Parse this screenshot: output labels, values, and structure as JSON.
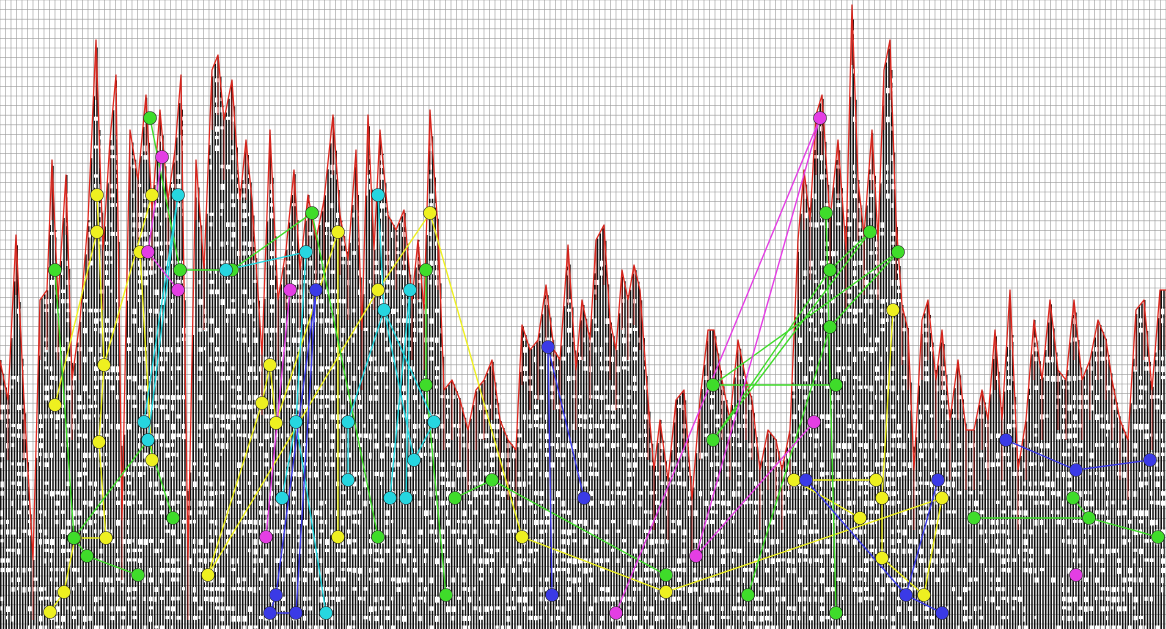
{
  "chart_data": {
    "type": "line",
    "colors": {
      "background": "#ffffff",
      "grid": "#9a9a9a",
      "bars": "#111111",
      "line": "#e0281e",
      "yellow": "#eef020",
      "green": "#3fdc2a",
      "cyan": "#26d6e0",
      "magenta": "#e43ee4",
      "blue": "#3a3ae6"
    },
    "profile": [
      [
        0,
        360
      ],
      [
        8,
        400
      ],
      [
        16,
        235
      ],
      [
        24,
        400
      ],
      [
        33,
        560
      ],
      [
        40,
        300
      ],
      [
        47,
        290
      ],
      [
        52,
        160
      ],
      [
        58,
        300
      ],
      [
        66,
        175
      ],
      [
        72,
        380
      ],
      [
        80,
        320
      ],
      [
        88,
        220
      ],
      [
        96,
        40
      ],
      [
        103,
        250
      ],
      [
        110,
        140
      ],
      [
        116,
        75
      ],
      [
        122,
        520
      ],
      [
        130,
        130
      ],
      [
        138,
        180
      ],
      [
        146,
        95
      ],
      [
        152,
        210
      ],
      [
        160,
        110
      ],
      [
        168,
        200
      ],
      [
        175,
        150
      ],
      [
        181,
        75
      ],
      [
        188,
        560
      ],
      [
        196,
        160
      ],
      [
        204,
        270
      ],
      [
        212,
        70
      ],
      [
        218,
        55
      ],
      [
        224,
        120
      ],
      [
        232,
        80
      ],
      [
        240,
        200
      ],
      [
        246,
        140
      ],
      [
        252,
        200
      ],
      [
        262,
        355
      ],
      [
        270,
        130
      ],
      [
        278,
        300
      ],
      [
        286,
        250
      ],
      [
        294,
        170
      ],
      [
        300,
        270
      ],
      [
        308,
        195
      ],
      [
        316,
        240
      ],
      [
        324,
        200
      ],
      [
        333,
        115
      ],
      [
        340,
        215
      ],
      [
        348,
        260
      ],
      [
        356,
        150
      ],
      [
        362,
        330
      ],
      [
        368,
        115
      ],
      [
        374,
        250
      ],
      [
        380,
        130
      ],
      [
        388,
        215
      ],
      [
        396,
        230
      ],
      [
        404,
        210
      ],
      [
        412,
        300
      ],
      [
        418,
        240
      ],
      [
        424,
        310
      ],
      [
        430,
        110
      ],
      [
        438,
        230
      ],
      [
        444,
        390
      ],
      [
        452,
        380
      ],
      [
        460,
        400
      ],
      [
        468,
        430
      ],
      [
        476,
        390
      ],
      [
        484,
        380
      ],
      [
        492,
        360
      ],
      [
        500,
        420
      ],
      [
        508,
        440
      ],
      [
        516,
        450
      ],
      [
        522,
        325
      ],
      [
        530,
        350
      ],
      [
        538,
        340
      ],
      [
        546,
        285
      ],
      [
        554,
        350
      ],
      [
        560,
        360
      ],
      [
        568,
        245
      ],
      [
        576,
        370
      ],
      [
        582,
        300
      ],
      [
        590,
        340
      ],
      [
        596,
        240
      ],
      [
        604,
        225
      ],
      [
        610,
        320
      ],
      [
        616,
        350
      ],
      [
        622,
        270
      ],
      [
        628,
        300
      ],
      [
        634,
        265
      ],
      [
        640,
        290
      ],
      [
        648,
        400
      ],
      [
        654,
        470
      ],
      [
        660,
        420
      ],
      [
        668,
        480
      ],
      [
        676,
        400
      ],
      [
        684,
        390
      ],
      [
        692,
        500
      ],
      [
        700,
        400
      ],
      [
        708,
        330
      ],
      [
        714,
        330
      ],
      [
        722,
        380
      ],
      [
        730,
        420
      ],
      [
        738,
        340
      ],
      [
        746,
        380
      ],
      [
        752,
        400
      ],
      [
        760,
        470
      ],
      [
        768,
        430
      ],
      [
        776,
        440
      ],
      [
        782,
        470
      ],
      [
        790,
        430
      ],
      [
        798,
        240
      ],
      [
        804,
        170
      ],
      [
        810,
        220
      ],
      [
        816,
        115
      ],
      [
        822,
        95
      ],
      [
        830,
        220
      ],
      [
        838,
        140
      ],
      [
        846,
        250
      ],
      [
        852,
        5
      ],
      [
        858,
        180
      ],
      [
        864,
        235
      ],
      [
        872,
        130
      ],
      [
        878,
        240
      ],
      [
        884,
        70
      ],
      [
        890,
        40
      ],
      [
        896,
        220
      ],
      [
        902,
        305
      ],
      [
        908,
        330
      ],
      [
        914,
        470
      ],
      [
        922,
        320
      ],
      [
        928,
        300
      ],
      [
        936,
        380
      ],
      [
        942,
        330
      ],
      [
        950,
        420
      ],
      [
        958,
        360
      ],
      [
        966,
        430
      ],
      [
        974,
        430
      ],
      [
        982,
        390
      ],
      [
        988,
        420
      ],
      [
        995,
        330
      ],
      [
        1002,
        420
      ],
      [
        1010,
        290
      ],
      [
        1018,
        470
      ],
      [
        1026,
        420
      ],
      [
        1034,
        320
      ],
      [
        1042,
        380
      ],
      [
        1050,
        300
      ],
      [
        1058,
        370
      ],
      [
        1066,
        380
      ],
      [
        1074,
        300
      ],
      [
        1082,
        380
      ],
      [
        1090,
        360
      ],
      [
        1098,
        320
      ],
      [
        1106,
        340
      ],
      [
        1112,
        380
      ],
      [
        1120,
        420
      ],
      [
        1128,
        440
      ],
      [
        1136,
        310
      ],
      [
        1144,
        300
      ],
      [
        1152,
        390
      ],
      [
        1160,
        290
      ],
      [
        1166,
        290
      ]
    ],
    "groups": [
      {
        "name": "yellow",
        "points": [
          [
            97,
            195
          ],
          [
            97,
            232
          ],
          [
            104,
            365
          ],
          [
            55,
            405
          ],
          [
            99,
            442
          ],
          [
            152,
            460
          ],
          [
            106,
            538
          ],
          [
            75,
            538
          ],
          [
            64,
            592
          ],
          [
            50,
            612
          ],
          [
            140,
            252
          ],
          [
            152,
            195
          ],
          [
            208,
            575
          ],
          [
            262,
            403
          ],
          [
            270,
            365
          ],
          [
            276,
            423
          ],
          [
            338,
            232
          ],
          [
            338,
            537
          ],
          [
            378,
            290
          ],
          [
            430,
            213
          ],
          [
            522,
            537
          ],
          [
            666,
            592
          ],
          [
            794,
            480
          ],
          [
            860,
            518
          ],
          [
            876,
            480
          ],
          [
            882,
            498
          ],
          [
            882,
            558
          ],
          [
            924,
            595
          ],
          [
            942,
            498
          ],
          [
            893,
            310
          ]
        ],
        "links": [
          [
            0,
            2
          ],
          [
            2,
            4
          ],
          [
            4,
            6
          ],
          [
            6,
            7
          ],
          [
            7,
            8
          ],
          [
            8,
            9
          ],
          [
            1,
            3
          ],
          [
            10,
            5
          ],
          [
            11,
            2
          ],
          [
            12,
            13
          ],
          [
            13,
            14
          ],
          [
            14,
            15
          ],
          [
            15,
            16
          ],
          [
            16,
            17
          ],
          [
            12,
            18
          ],
          [
            18,
            19
          ],
          [
            19,
            20
          ],
          [
            20,
            21
          ],
          [
            22,
            23
          ],
          [
            22,
            24
          ],
          [
            25,
            26
          ],
          [
            26,
            27
          ],
          [
            28,
            27
          ],
          [
            29,
            25
          ],
          [
            21,
            28
          ]
        ]
      },
      {
        "name": "green",
        "points": [
          [
            55,
            270
          ],
          [
            74,
            538
          ],
          [
            87,
            556
          ],
          [
            138,
            575
          ],
          [
            148,
            440
          ],
          [
            150,
            118
          ],
          [
            173,
            518
          ],
          [
            180,
            270
          ],
          [
            232,
            270
          ],
          [
            312,
            213
          ],
          [
            378,
            537
          ],
          [
            426,
            270
          ],
          [
            426,
            385
          ],
          [
            446,
            595
          ],
          [
            455,
            498
          ],
          [
            492,
            480
          ],
          [
            666,
            575
          ],
          [
            713,
            385
          ],
          [
            713,
            440
          ],
          [
            748,
            595
          ],
          [
            826,
            213
          ],
          [
            830,
            270
          ],
          [
            830,
            327
          ],
          [
            836,
            385
          ],
          [
            836,
            613
          ],
          [
            870,
            232
          ],
          [
            898,
            252
          ],
          [
            974,
            518
          ],
          [
            1073,
            498
          ],
          [
            1089,
            518
          ],
          [
            1158,
            537
          ]
        ],
        "links": [
          [
            0,
            1
          ],
          [
            1,
            2
          ],
          [
            2,
            3
          ],
          [
            4,
            1
          ],
          [
            5,
            7
          ],
          [
            7,
            8
          ],
          [
            8,
            9
          ],
          [
            9,
            10
          ],
          [
            11,
            12
          ],
          [
            12,
            13
          ],
          [
            14,
            15
          ],
          [
            15,
            16
          ],
          [
            17,
            23
          ],
          [
            18,
            21
          ],
          [
            19,
            22
          ],
          [
            20,
            24
          ],
          [
            21,
            25
          ],
          [
            22,
            26
          ],
          [
            25,
            18
          ],
          [
            26,
            17
          ],
          [
            27,
            29
          ],
          [
            28,
            29
          ],
          [
            29,
            30
          ],
          [
            6,
            4
          ]
        ]
      },
      {
        "name": "cyan",
        "points": [
          [
            178,
            195
          ],
          [
            144,
            422
          ],
          [
            148,
            440
          ],
          [
            226,
            270
          ],
          [
            306,
            252
          ],
          [
            296,
            422
          ],
          [
            282,
            498
          ],
          [
            326,
            613
          ],
          [
            378,
            195
          ],
          [
            384,
            310
          ],
          [
            410,
            290
          ],
          [
            348,
            422
          ],
          [
            348,
            480
          ],
          [
            414,
            460
          ],
          [
            390,
            498
          ],
          [
            406,
            498
          ],
          [
            434,
            422
          ]
        ],
        "links": [
          [
            0,
            1
          ],
          [
            0,
            2
          ],
          [
            3,
            4
          ],
          [
            4,
            5
          ],
          [
            5,
            6
          ],
          [
            5,
            7
          ],
          [
            8,
            9
          ],
          [
            9,
            11
          ],
          [
            9,
            13
          ],
          [
            10,
            14
          ],
          [
            10,
            15
          ],
          [
            11,
            12
          ],
          [
            13,
            16
          ],
          [
            9,
            16
          ]
        ]
      },
      {
        "name": "magenta",
        "points": [
          [
            162,
            157
          ],
          [
            148,
            252
          ],
          [
            178,
            290
          ],
          [
            290,
            290
          ],
          [
            266,
            537
          ],
          [
            820,
            118
          ],
          [
            616,
            613
          ],
          [
            696,
            556
          ],
          [
            814,
            422
          ],
          [
            1076,
            575
          ]
        ],
        "links": [
          [
            0,
            1
          ],
          [
            1,
            2
          ],
          [
            3,
            4
          ],
          [
            5,
            6
          ],
          [
            5,
            7
          ],
          [
            7,
            8
          ]
        ]
      },
      {
        "name": "blue",
        "points": [
          [
            316,
            290
          ],
          [
            276,
            595
          ],
          [
            270,
            613
          ],
          [
            296,
            613
          ],
          [
            548,
            347
          ],
          [
            552,
            595
          ],
          [
            584,
            498
          ],
          [
            806,
            480
          ],
          [
            906,
            595
          ],
          [
            938,
            480
          ],
          [
            942,
            613
          ],
          [
            1006,
            440
          ],
          [
            1076,
            470
          ],
          [
            1150,
            460
          ]
        ],
        "links": [
          [
            0,
            1
          ],
          [
            1,
            2
          ],
          [
            2,
            3
          ],
          [
            0,
            3
          ],
          [
            4,
            5
          ],
          [
            4,
            6
          ],
          [
            7,
            8
          ],
          [
            9,
            8
          ],
          [
            8,
            10
          ],
          [
            11,
            12
          ],
          [
            12,
            13
          ]
        ]
      }
    ]
  }
}
